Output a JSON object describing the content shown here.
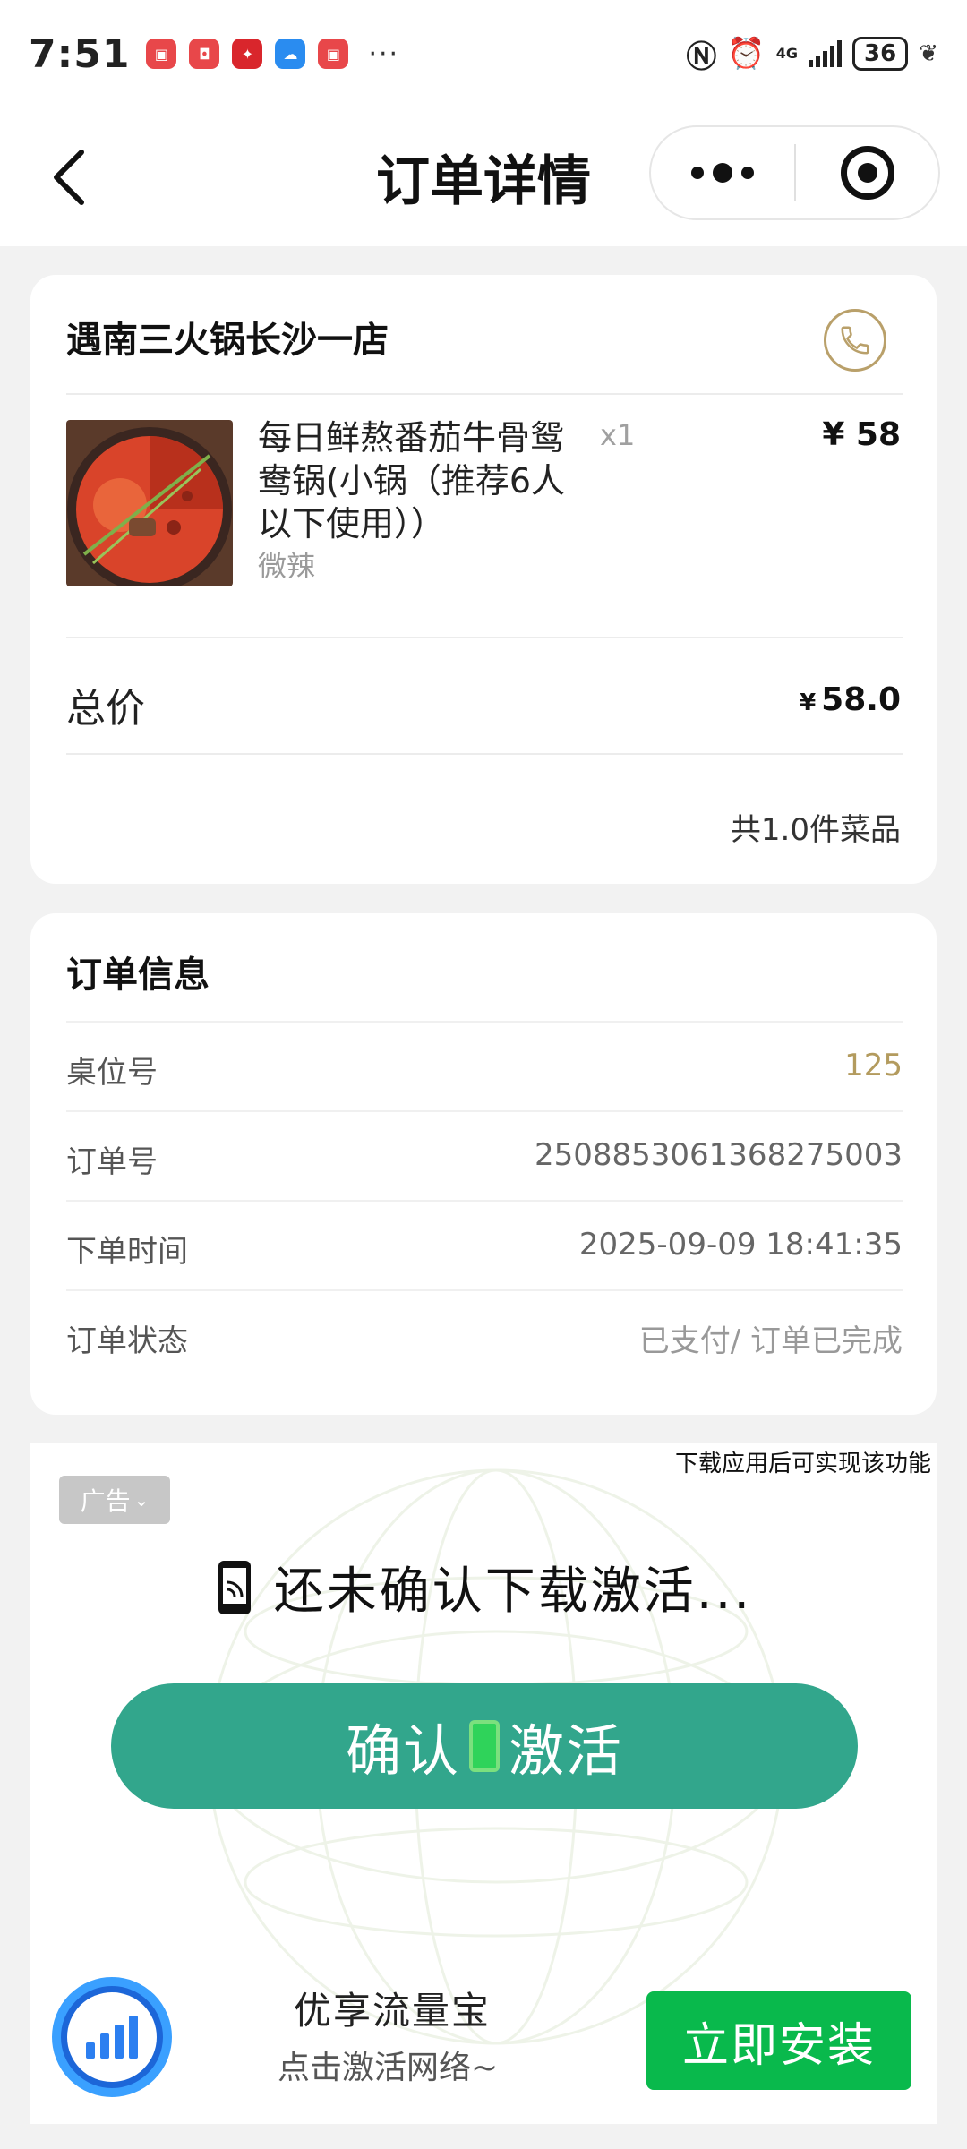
{
  "status_bar": {
    "time": "7:51",
    "more": "···",
    "network": "4G",
    "battery": "36"
  },
  "nav": {
    "title": "订单详情"
  },
  "order": {
    "store_name": "遇南三火锅长沙一店",
    "item": {
      "name": "每日鲜熬番茄牛骨鸳鸯锅(小锅（推荐6人以下使用））",
      "spec": "微辣",
      "qty": "x1",
      "price": "¥ 58"
    },
    "total_label": "总价",
    "total_currency": "¥",
    "total_value": "58.0",
    "item_count": "共1.0件菜品"
  },
  "order_info": {
    "title": "订单信息",
    "rows": [
      {
        "label": "桌位号",
        "value": "125"
      },
      {
        "label": "订单号",
        "value": "2508853061368275003"
      },
      {
        "label": "下单时间",
        "value": "2025-09-09 18:41:35"
      },
      {
        "label": "订单状态",
        "value": "已支付/ 订单已完成"
      }
    ]
  },
  "ad": {
    "hint": "下载应用后可实现该功能",
    "badge": "广告",
    "heading": "还未确认下载激活...",
    "cta_left": "确认",
    "cta_right": "激活",
    "app_name": "优享流量宝",
    "app_sub": "点击激活网络~",
    "install": "立即安装"
  },
  "colors": {
    "accent_gold": "#b39b5e",
    "cta_green": "#32a68c",
    "install_green": "#09b94c"
  }
}
